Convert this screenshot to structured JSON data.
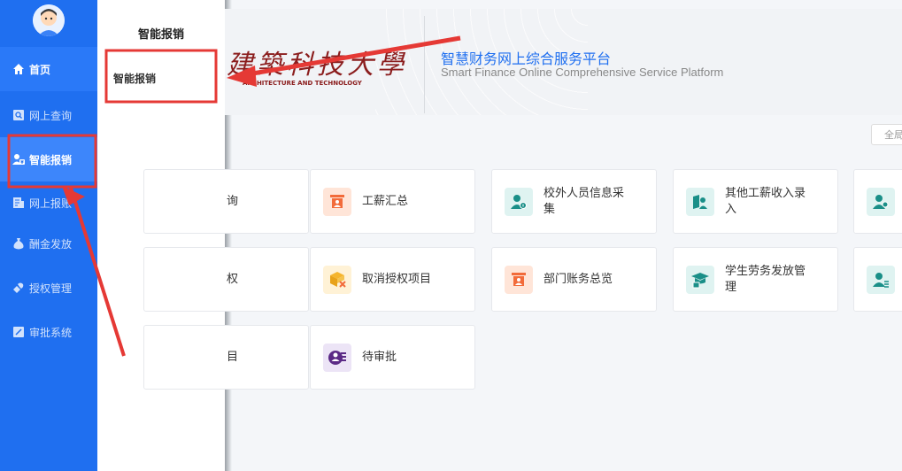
{
  "sidebar": {
    "items": [
      {
        "label": "首页",
        "icon": "home-icon"
      },
      {
        "label": "网上查询",
        "icon": "query-icon"
      },
      {
        "label": "智能报销",
        "icon": "reimburse-icon"
      },
      {
        "label": "网上报账",
        "icon": "report-icon"
      },
      {
        "label": "酬金发放",
        "icon": "money-bag-icon"
      },
      {
        "label": "授权管理",
        "icon": "authorize-icon"
      },
      {
        "label": "审批系统",
        "icon": "approval-icon"
      }
    ]
  },
  "subpanel": {
    "title": "智能报销",
    "items": [
      "智能报销"
    ]
  },
  "header": {
    "logo_script": "建築科技大學",
    "logo_en": "ARCHITECTURE AND TECHNOLOGY",
    "title_cn": "智慧财务网上综合服务平台",
    "title_en": "Smart Finance Online Comprehensive Service Platform",
    "fullscreen_label": "全局"
  },
  "cards": [
    {
      "label": "询",
      "icon": ""
    },
    {
      "label": "工薪汇总",
      "icon": "salary-summary-icon"
    },
    {
      "label": "校外人员信息采集",
      "icon": "external-person-icon"
    },
    {
      "label": "其他工薪收入录入",
      "icon": "other-income-icon"
    },
    {
      "label": "",
      "icon": "user-add-icon"
    },
    {
      "label": "权",
      "icon": ""
    },
    {
      "label": "取消授权项目",
      "icon": "cancel-authorize-icon"
    },
    {
      "label": "部门账务总览",
      "icon": "department-account-icon"
    },
    {
      "label": "学生劳务发放管理",
      "icon": "student-labor-icon"
    },
    {
      "label": "",
      "icon": "user-list-icon"
    },
    {
      "label": "目",
      "icon": ""
    },
    {
      "label": "待审批",
      "icon": "pending-approval-icon"
    }
  ],
  "colors": {
    "sidebar": "#1f6ff0",
    "annotation_red": "#e53935",
    "title_blue": "#1f6ff0"
  }
}
